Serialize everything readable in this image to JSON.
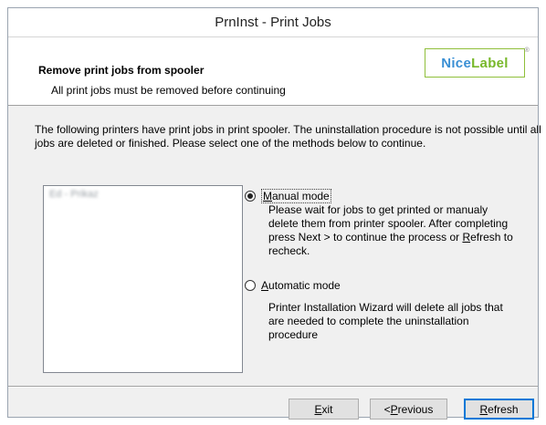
{
  "window": {
    "title": "PrnInst - Print Jobs"
  },
  "header": {
    "title": "Remove print jobs from spooler",
    "subtitle": "All print jobs must be removed before continuing",
    "logo_part1": "Nice",
    "logo_part2": "Label",
    "logo_mark": "®",
    "logo_accent_color": "#78b82a",
    "logo_text_color": "#3a8fd4"
  },
  "description": "The following printers have print jobs in print spooler. The uninstallation procedure is not possible until all jobs are deleted or finished. Please select one of the methods below to continue.",
  "printer_list": {
    "items": [
      "Ed - Prikaz"
    ]
  },
  "modes": {
    "manual": {
      "label_access": "M",
      "label_rest": "anual mode",
      "selected": true,
      "desc_part1": "Please wait for jobs to get printed or manualy delete them from printer spooler. After completing press Next > to continue the process or ",
      "desc_access": "R",
      "desc_part2": "efresh to recheck."
    },
    "automatic": {
      "label_access": "A",
      "label_rest": "utomatic mode",
      "selected": false,
      "desc": "Printer Installation Wizard will delete all jobs that are needed to complete the uninstallation procedure"
    }
  },
  "buttons": {
    "exit_access": "E",
    "exit_rest": "xit",
    "previous_prefix": "< ",
    "previous_access": "P",
    "previous_rest": "revious",
    "refresh_access": "R",
    "refresh_rest": "efresh"
  }
}
